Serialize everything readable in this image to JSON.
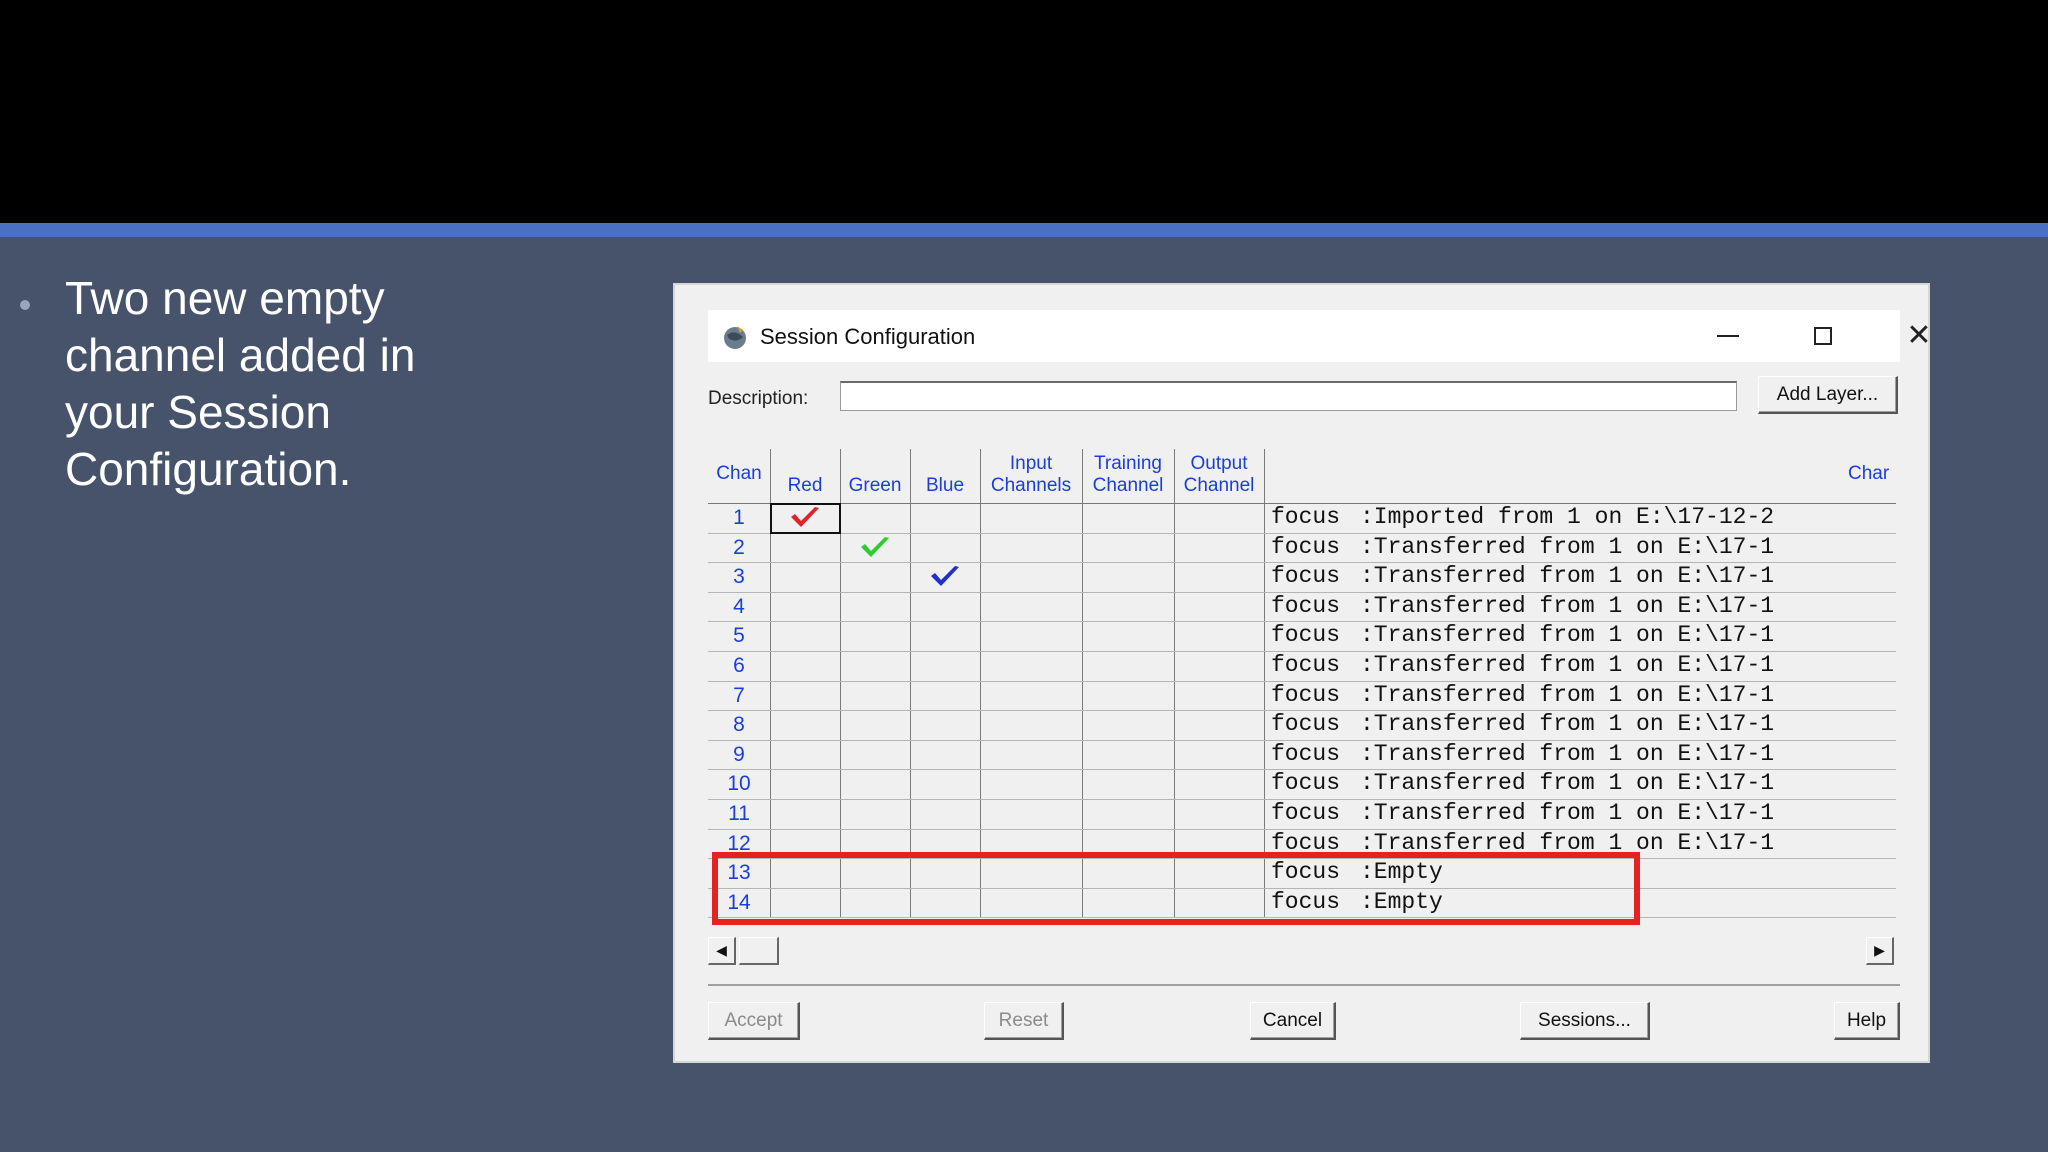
{
  "slide": {
    "bullet": "Two new empty channel added in your Session Configuration."
  },
  "window": {
    "title": "Session Configuration",
    "app_icon": "globe-app-icon",
    "controls": {
      "minimize": "minimize-icon",
      "maximize": "maximize-icon",
      "close": "close-icon",
      "close_glyph": "✕"
    }
  },
  "description": {
    "label": "Description:",
    "value": "",
    "add_layer_label": "Add Layer..."
  },
  "table": {
    "columns": {
      "chan": "Chan",
      "red": "Red",
      "green": "Green",
      "blue": "Blue",
      "input_1": "Input",
      "input_2": "Channels",
      "training_1": "Training",
      "training_2": "Channel",
      "output_1": "Output",
      "output_2": "Channel",
      "right_trunc": "Char"
    },
    "rows": [
      {
        "num": "1",
        "name": "focus",
        "desc": ":Imported from 1 on E:\\17-12-2"
      },
      {
        "num": "2",
        "name": "focus",
        "desc": ":Transferred from 1 on E:\\17-1"
      },
      {
        "num": "3",
        "name": "focus",
        "desc": ":Transferred from 1 on E:\\17-1"
      },
      {
        "num": "4",
        "name": "focus",
        "desc": ":Transferred from 1 on E:\\17-1"
      },
      {
        "num": "5",
        "name": "focus",
        "desc": ":Transferred from 1 on E:\\17-1"
      },
      {
        "num": "6",
        "name": "focus",
        "desc": ":Transferred from 1 on E:\\17-1"
      },
      {
        "num": "7",
        "name": "focus",
        "desc": ":Transferred from 1 on E:\\17-1"
      },
      {
        "num": "8",
        "name": "focus",
        "desc": ":Transferred from 1 on E:\\17-1"
      },
      {
        "num": "9",
        "name": "focus",
        "desc": ":Transferred from 1 on E:\\17-1"
      },
      {
        "num": "10",
        "name": "focus",
        "desc": ":Transferred from 1 on E:\\17-1"
      },
      {
        "num": "11",
        "name": "focus",
        "desc": ":Transferred from 1 on E:\\17-1"
      },
      {
        "num": "12",
        "name": "focus",
        "desc": ":Transferred from 1 on E:\\17-1"
      },
      {
        "num": "13",
        "name": "focus",
        "desc": ":Empty"
      },
      {
        "num": "14",
        "name": "focus",
        "desc": ":Empty"
      }
    ],
    "checks": {
      "red_row": "1",
      "red_color": "#e0222b",
      "green_row": "2",
      "green_color": "#2ecc2e",
      "blue_row": "3",
      "blue_color": "#1f2fd0"
    },
    "highlight_color": "#e32222"
  },
  "buttons": {
    "accept": "Accept",
    "reset": "Reset",
    "cancel": "Cancel",
    "sessions": "Sessions...",
    "help": "Help"
  },
  "scroll": {
    "left_glyph": "◀",
    "right_glyph": "▶"
  }
}
